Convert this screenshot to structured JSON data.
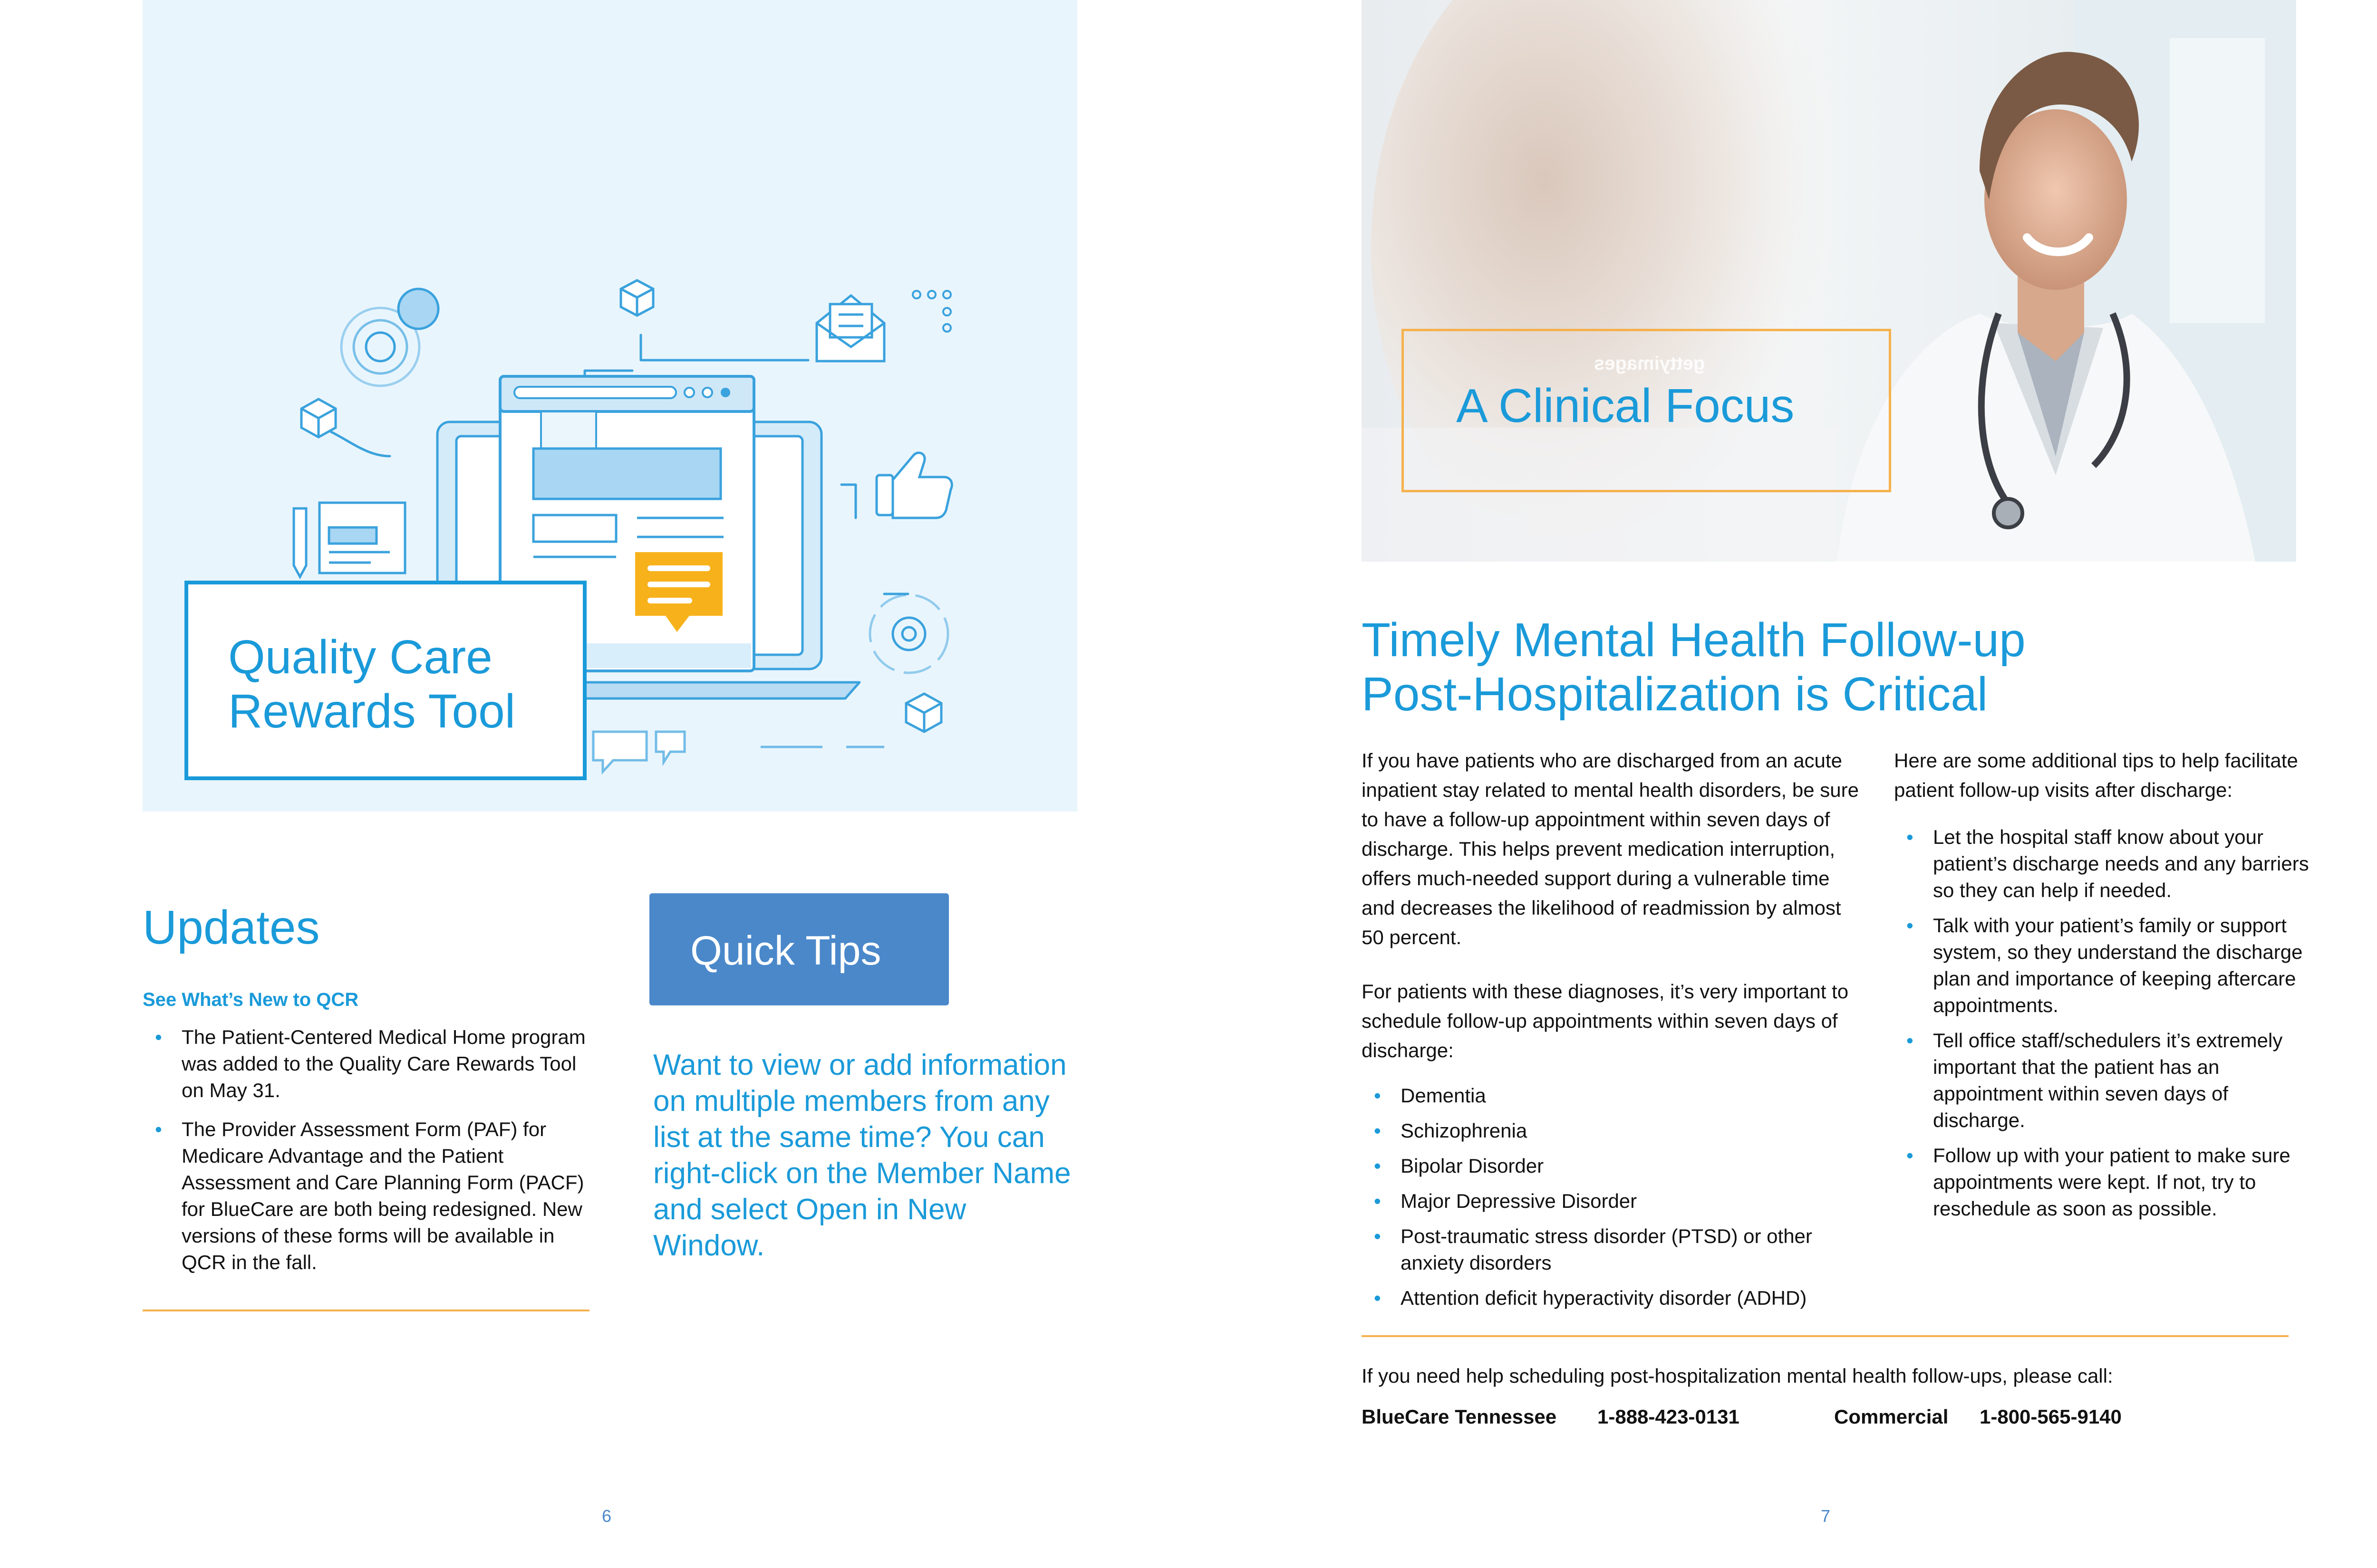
{
  "left_page": {
    "qcr_title_line1": "Quality Care",
    "qcr_title_line2": "Rewards Tool",
    "updates_heading": "Updates",
    "updates_subheading": "See What’s New to QCR",
    "updates_items": [
      "The Patient-Centered Medical Home program was added to the Quality Care Rewards Tool on May 31.",
      "The Provider Assessment Form (PAF) for Medicare Advantage and the Patient Assessment and Care Planning Form (PACF) for BlueCare are both being redesigned. New versions of these forms will be available in QCR in the fall."
    ],
    "quick_tips_label": "Quick Tips",
    "quick_tips_text": "Want to view or add information on multiple members from any list at the same time? You can right-click on the Member Name and select Open in New Window.",
    "page_number": "6"
  },
  "right_page": {
    "photo_watermark": "gettyimages",
    "section_title": "A Clinical Focus",
    "article_title_line1": "Timely Mental Health Follow-up",
    "article_title_line2": "Post-Hospitalization is Critical",
    "col1_para1": "If you have patients who are discharged from an acute inpatient stay related to mental health disorders, be sure to have a follow-up appointment within seven days of discharge. This helps prevent medication interruption, offers much-needed support during a vulnerable time and decreases the likelihood of readmission by almost 50 percent.",
    "col1_para2": "For patients with these diagnoses, it’s very important to schedule follow-up appointments within seven days of discharge:",
    "diagnoses": [
      "Dementia",
      "Schizophrenia",
      "Bipolar Disorder",
      "Major Depressive Disorder",
      "Post-traumatic stress disorder (PTSD) or other anxiety disorders",
      "Attention deficit hyperactivity disorder (ADHD)"
    ],
    "col2_intro": "Here are some additional tips to help facilitate patient follow-up visits after discharge:",
    "tips": [
      "Let the hospital staff know about your patient’s discharge needs and any barriers so they can help if needed.",
      "Talk with your patient’s family or support system, so they understand the discharge plan and importance of keeping aftercare appointments.",
      "Tell office staff/schedulers it’s extremely important that the patient has an appointment within seven days of discharge.",
      "Follow up with your patient to make sure appointments were kept. If not, try to reschedule as soon as possible."
    ],
    "call_line": "If you need help scheduling post-hospitalization mental health follow-ups, please call:",
    "contact_1_name": "BlueCare Tennessee",
    "contact_1_phone": "1-888-423-0131",
    "contact_2_name": "Commercial",
    "contact_2_phone": "1-800-565-9140",
    "page_number": "7"
  },
  "colors": {
    "accent_blue": "#1a9ad9",
    "button_blue": "#4a88ca",
    "rule_orange": "#f5b14c",
    "illustration_bg": "#e9f5fd",
    "speech_yellow": "#f7b21b"
  },
  "icons": [
    "laptop-icon",
    "browser-window-icon",
    "speech-bubble-icon",
    "envelope-icon",
    "thumbs-up-icon",
    "gear-cycle-icon",
    "cube-icon",
    "target-icon",
    "pencil-icon",
    "chat-icon"
  ]
}
